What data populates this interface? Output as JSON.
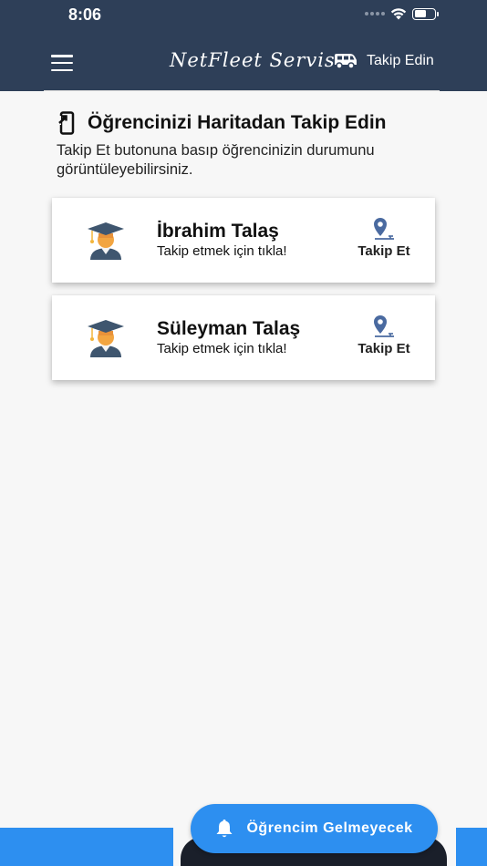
{
  "status": {
    "time": "8:06"
  },
  "header": {
    "brand": "NetFleet Servis",
    "follow_label": "Takip Edin"
  },
  "section": {
    "title": "Öğrencinizi Haritadan Takip Edin",
    "description": "Takip Et butonuna basıp öğrencinizin durumunu görüntüleyebilirsiniz."
  },
  "students": [
    {
      "name": "İbrahim Talaş",
      "hint": "Takip etmek için tıkla!",
      "action": "Takip Et"
    },
    {
      "name": "Süleyman Talaş",
      "hint": "Takip etmek için tıkla!",
      "action": "Takip Et"
    }
  ],
  "bottom": {
    "absent_label": "Öğrencim Gelmeyecek"
  },
  "colors": {
    "header_bg": "#2e3f58",
    "accent": "#2d8ff0",
    "pin": "#4a6aa0"
  },
  "icons": {
    "menu": "menu-icon",
    "bus": "bus-icon",
    "phone_arrow": "phone-arrow-icon",
    "student": "graduate-avatar-icon",
    "location": "location-pin-icon",
    "bell": "bell-icon"
  }
}
